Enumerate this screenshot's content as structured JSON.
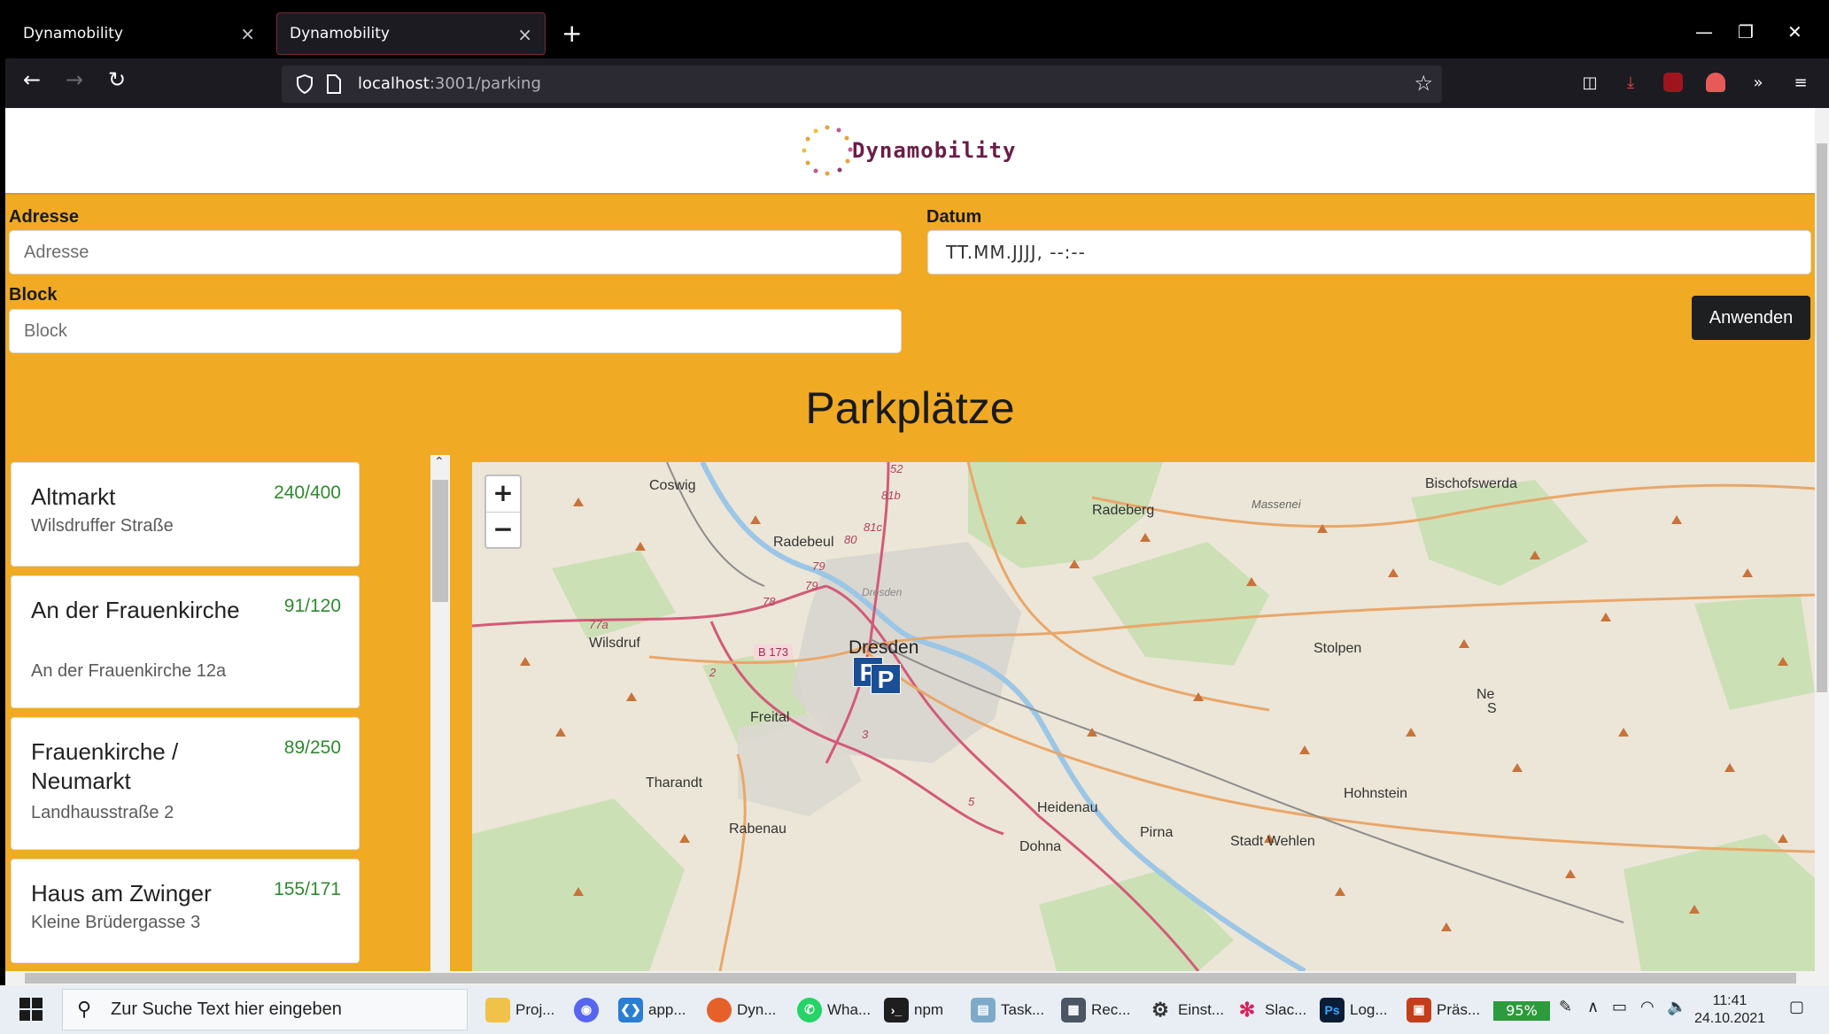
{
  "browser": {
    "tabs": [
      {
        "title": "Dynamobility",
        "active": false
      },
      {
        "title": "Dynamobility",
        "active": true
      }
    ],
    "url_host": "localhost",
    "url_rest": ":3001/parking"
  },
  "header": {
    "brand": "Dynamobility"
  },
  "filters": {
    "address_label": "Adresse",
    "address_placeholder": "Adresse",
    "date_label": "Datum",
    "date_placeholder": "TT.MM.JJJJ, --:--",
    "block_label": "Block",
    "block_placeholder": "Block",
    "apply_label": "Anwenden"
  },
  "section_title": "Parkplätze",
  "parking_list": [
    {
      "name": "Altmarkt",
      "address": "Wilsdruffer Straße",
      "count": "240/400"
    },
    {
      "name": "An der Frauenkirche",
      "address": "An der Frauenkirche 12a",
      "count": "91/120"
    },
    {
      "name": "Frauenkirche / Neumarkt",
      "address": "Landhausstraße 2",
      "count": "89/250"
    },
    {
      "name": "Haus am Zwinger",
      "address": "Kleine Brüdergasse 3",
      "count": "155/171"
    }
  ],
  "map": {
    "zoom_in": "+",
    "zoom_out": "−",
    "places": {
      "coswig": "Coswig",
      "radebeul": "Radebeul",
      "radeberg": "Radeberg",
      "massenei": "Massenei",
      "bischofswerda": "Bischofswerda",
      "wilsdruf": "Wilsdruf",
      "dresden": "Dresden",
      "stolpen": "Stolpen",
      "freital": "Freital",
      "tharandt": "Tharandt",
      "rabenau": "Rabenau",
      "heidenau": "Heidenau",
      "pirna": "Pirna",
      "dohna": "Dohna",
      "hohnstein": "Hohnstein",
      "stadt_wehlen": "Stadt Wehlen",
      "ne": "Ne",
      "s": "S",
      "dresden_small": "Dresden"
    },
    "roads": {
      "b173": "B 173",
      "r81b": "81b",
      "r81c": "81c",
      "r80": "80",
      "r79a": "79",
      "r79b": "79",
      "r78": "78",
      "r77a": "77a",
      "r2": "2",
      "r3": "3",
      "r5": "5",
      "r52": "52"
    },
    "marker_label_1": "P",
    "marker_label_2": "P"
  },
  "taskbar": {
    "search_placeholder": "Zur Suche Text hier eingeben",
    "items": [
      "Proj...",
      "app...",
      "Dyn...",
      "Wha...",
      "npm",
      "Task...",
      "Rec...",
      "Einst...",
      "Slac...",
      "Log...",
      "Präs..."
    ],
    "battery": "95%",
    "time": "11:41",
    "date": "24.10.2021"
  },
  "colors": {
    "page_bg": "#f0aa24",
    "brand": "#6b1c46",
    "count_green": "#2e8b2e",
    "marker_blue": "#1a4e95"
  }
}
